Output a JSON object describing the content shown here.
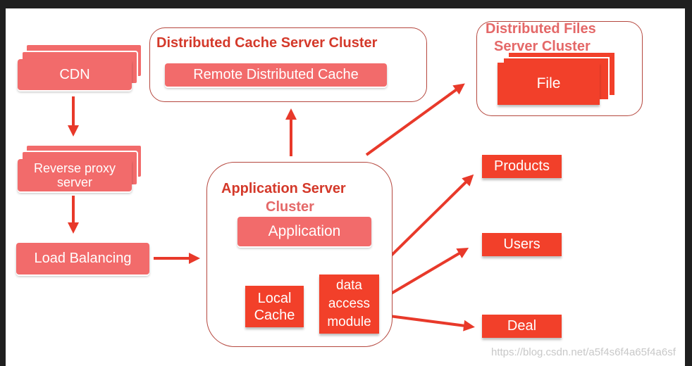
{
  "colors": {
    "light_box": "#f26b6b",
    "bright_box": "#f2402a",
    "title": "#d4392a",
    "arrow": "#e8392a"
  },
  "cdn": {
    "label": "CDN"
  },
  "reverse_proxy": {
    "label_line1": "Reverse proxy",
    "label_line2": "server"
  },
  "load_balancing": {
    "label": "Load Balancing"
  },
  "cache_cluster": {
    "title": "Distributed Cache Server Cluster",
    "item": "Remote Distributed Cache"
  },
  "app_cluster": {
    "title_line1": "Application Server",
    "title_line2": "Cluster",
    "application": "Application",
    "local_cache_line1": "Local",
    "local_cache_line2": "Cache",
    "dam_line1": "data",
    "dam_line2": "access",
    "dam_line3": "module"
  },
  "files_cluster": {
    "title_line1": "Distributed Files",
    "title_line2": "Server Cluster",
    "item": "File"
  },
  "stores": [
    "Products",
    "Users",
    "Deal"
  ],
  "watermark": "https://blog.csdn.net/a5f4s6f4a65f4a6sf"
}
